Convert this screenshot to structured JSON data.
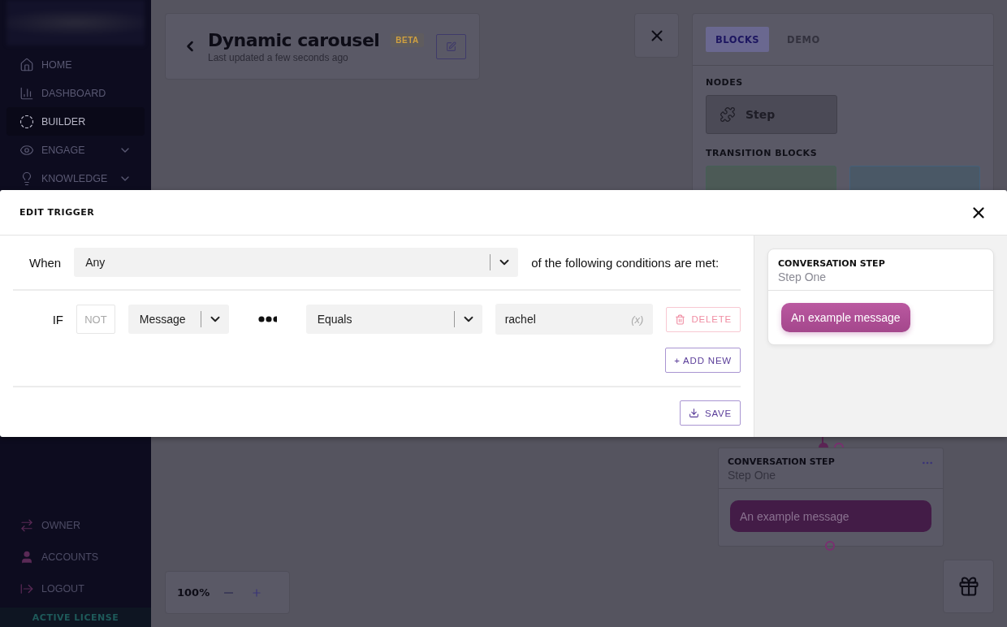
{
  "sidebar": {
    "items": [
      {
        "label": "HOME",
        "selected": false,
        "expandable": false
      },
      {
        "label": "DASHBOARD",
        "selected": false,
        "expandable": false
      },
      {
        "label": "BUILDER",
        "selected": true,
        "expandable": false
      },
      {
        "label": "ENGAGE",
        "selected": false,
        "expandable": true
      },
      {
        "label": "KNOWLEDGE",
        "selected": false,
        "expandable": true
      }
    ],
    "footer_items": [
      {
        "label": "OWNER"
      },
      {
        "label": "ACCOUNTS"
      },
      {
        "label": "LOGOUT"
      }
    ],
    "license": "ACTIVE LICENSE"
  },
  "header": {
    "title": "Dynamic carousel",
    "badge": "BETA",
    "subtitle": "Last updated a few seconds ago"
  },
  "panel": {
    "tabs": [
      {
        "label": "BLOCKS",
        "selected": true
      },
      {
        "label": "DEMO",
        "selected": false
      }
    ],
    "nodes_heading": "NODES",
    "nodes": [
      {
        "label": "Step"
      }
    ],
    "transition_heading": "TRANSITION BLOCKS"
  },
  "canvas_node": {
    "kind_label": "CONVERSATION STEP",
    "name": "Step One",
    "message": "An example message"
  },
  "zoom": {
    "value": "100%"
  },
  "modal": {
    "title": "EDIT TRIGGER",
    "when_label": "When",
    "match": "Any",
    "match_suffix": "of the following conditions are met:",
    "conditions": [
      {
        "keyword": "IF",
        "negate_label": "NOT",
        "negated": false,
        "field": "Message",
        "operator": "Equals",
        "value": "rachel",
        "variable_hint": "(x)",
        "delete_label": "DELETE"
      }
    ],
    "add_label": "+ ADD NEW",
    "save_label": "SAVE",
    "preview": {
      "kind_label": "CONVERSATION STEP",
      "name": "Step One",
      "message": "An example message"
    }
  }
}
